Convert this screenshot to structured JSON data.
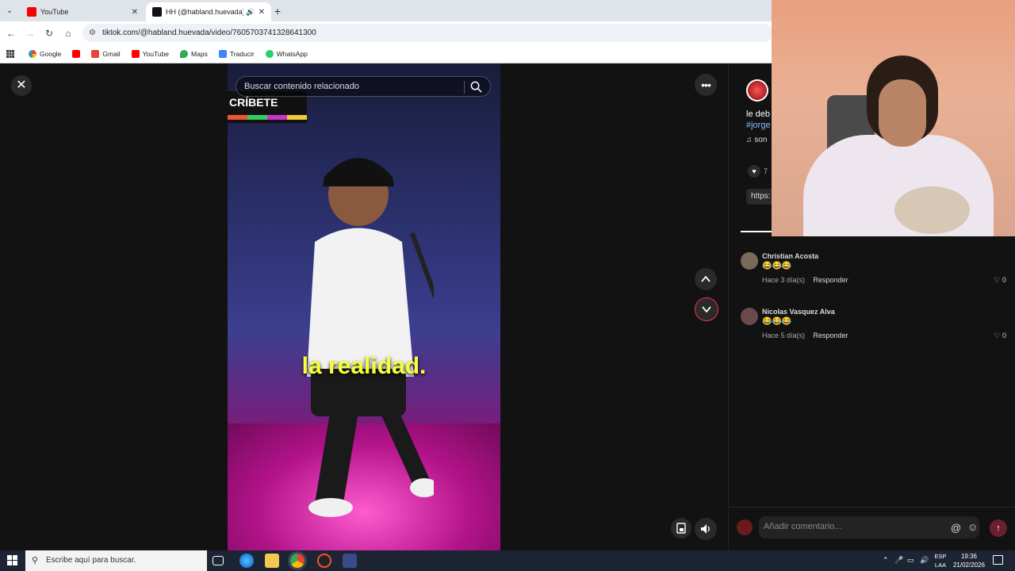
{
  "browser": {
    "tabs": [
      {
        "title": "YouTube",
        "favicon_color": "#ff0000"
      },
      {
        "title": "HH (@habland.huevada) | T",
        "favicon_color": "#111111"
      }
    ],
    "url": "tiktok.com/@habland.huevada/video/7605703741328641300",
    "bookmarks": [
      "Google",
      "Gmail",
      "YouTube",
      "Maps",
      "Traducir",
      "WhatsApp"
    ]
  },
  "tiktok": {
    "search_placeholder": "Buscar contenido relacionado",
    "video_overlay_badge": "CRÍBETE",
    "subtitle": "la realidad.",
    "description_snippet": "le deb",
    "hashtag_snippet": "#jorge",
    "music_snippet": "♫ son",
    "like_snippet": "7",
    "link_snippet": "https:",
    "comments": [
      {
        "name": "Christian Acosta",
        "text": "😂😂😂",
        "time": "Hace 3 día(s)",
        "reply": "Responder",
        "likes": "0"
      },
      {
        "name": "Nicolas Vasquez Alva",
        "text": "😂😂😂",
        "time": "Hace 5 día(s)",
        "reply": "Responder",
        "likes": "0"
      }
    ],
    "comment_placeholder": "Añadir comentario..."
  },
  "taskbar": {
    "search_placeholder": "Escribe aquí para buscar.",
    "lang_top": "ESP",
    "lang_bottom": "LAA",
    "time": "19:36",
    "date": "21/02/2026"
  },
  "colors": {
    "accent": "#fe2c55",
    "subtitle": "#f6ff3a"
  }
}
